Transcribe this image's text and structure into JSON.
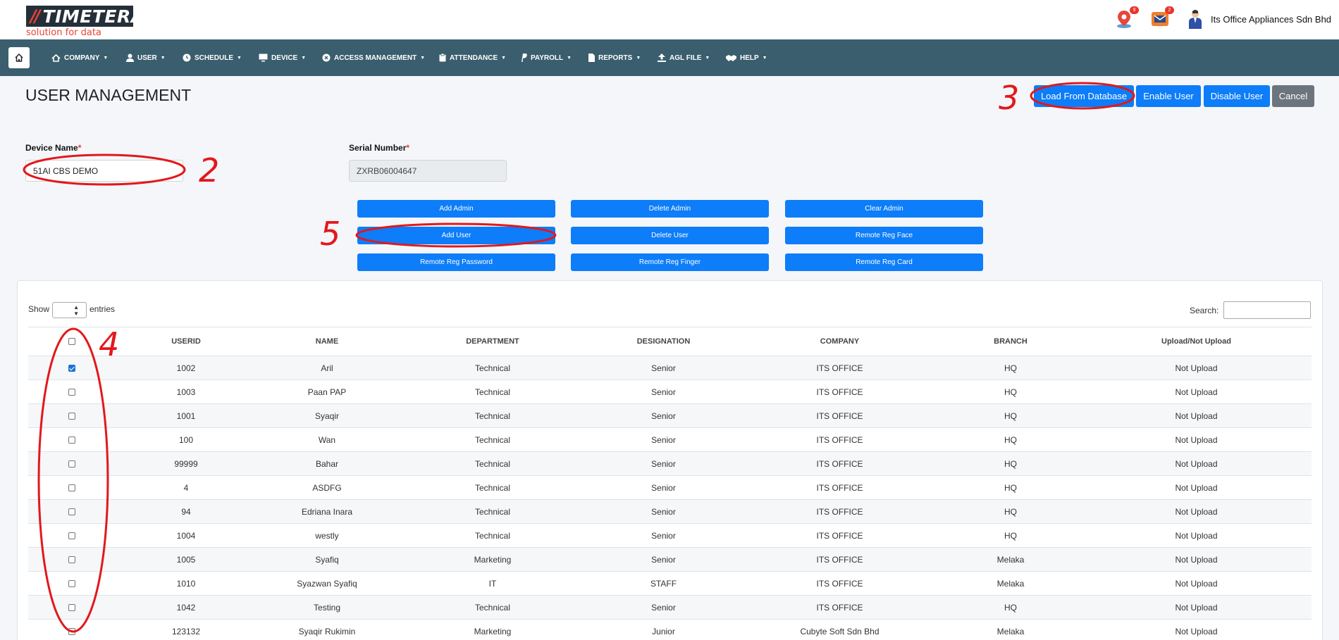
{
  "brand": {
    "name": "TIMETERA",
    "tagline": "solution for data"
  },
  "header": {
    "location_badge": "9",
    "mail_badge": "2",
    "company_name": "Its Office Appliances Sdn Bhd"
  },
  "nav": {
    "items": [
      {
        "label": "COMPANY",
        "icon": "company-icon"
      },
      {
        "label": "USER",
        "icon": "user-icon"
      },
      {
        "label": "SCHEDULE",
        "icon": "clock-icon"
      },
      {
        "label": "DEVICE",
        "icon": "monitor-icon"
      },
      {
        "label": "ACCESS MANAGEMENT",
        "icon": "access-icon"
      },
      {
        "label": "ATTENDANCE",
        "icon": "clipboard-icon"
      },
      {
        "label": "PAYROLL",
        "icon": "paypal-icon"
      },
      {
        "label": "REPORTS",
        "icon": "file-icon"
      },
      {
        "label": "AGL FILE",
        "icon": "upload-icon"
      },
      {
        "label": "HELP",
        "icon": "handshake-icon"
      }
    ]
  },
  "page": {
    "title": "USER MANAGEMENT"
  },
  "top_actions": {
    "load": "Load From Database",
    "enable": "Enable User",
    "disable": "Disable User",
    "cancel": "Cancel"
  },
  "form": {
    "device_label": "Device Name",
    "device_value": "51AI CBS DEMO",
    "serial_label": "Serial Number",
    "serial_value": "ZXRB06004647",
    "required_mark": "*"
  },
  "actions": {
    "add_admin": "Add Admin",
    "delete_admin": "Delete Admin",
    "clear_admin": "Clear Admin",
    "add_user": "Add User",
    "delete_user": "Delete User",
    "remote_face": "Remote Reg Face",
    "remote_password": "Remote Reg Password",
    "remote_finger": "Remote Reg Finger",
    "remote_card": "Remote Reg Card"
  },
  "table": {
    "show_label": "Show",
    "entries_label": "entries",
    "search_label": "Search:",
    "columns": [
      "USERID",
      "NAME",
      "DEPARTMENT",
      "DESIGNATION",
      "COMPANY",
      "BRANCH",
      "Upload/Not Upload"
    ],
    "rows": [
      {
        "checked": true,
        "cells": [
          "1002",
          "Aril",
          "Technical",
          "Senior",
          "ITS OFFICE",
          "HQ",
          "Not Upload"
        ]
      },
      {
        "checked": false,
        "cells": [
          "1003",
          "Paan PAP",
          "Technical",
          "Senior",
          "ITS OFFICE",
          "HQ",
          "Not Upload"
        ]
      },
      {
        "checked": false,
        "cells": [
          "1001",
          "Syaqir",
          "Technical",
          "Senior",
          "ITS OFFICE",
          "HQ",
          "Not Upload"
        ]
      },
      {
        "checked": false,
        "cells": [
          "100",
          "Wan",
          "Technical",
          "Senior",
          "ITS OFFICE",
          "HQ",
          "Not Upload"
        ]
      },
      {
        "checked": false,
        "cells": [
          "99999",
          "Bahar",
          "Technical",
          "Senior",
          "ITS OFFICE",
          "HQ",
          "Not Upload"
        ]
      },
      {
        "checked": false,
        "cells": [
          "4",
          "ASDFG",
          "Technical",
          "Senior",
          "ITS OFFICE",
          "HQ",
          "Not Upload"
        ]
      },
      {
        "checked": false,
        "cells": [
          "94",
          "Edriana Inara",
          "Technical",
          "Senior",
          "ITS OFFICE",
          "HQ",
          "Not Upload"
        ]
      },
      {
        "checked": false,
        "cells": [
          "1004",
          "westly",
          "Technical",
          "Senior",
          "ITS OFFICE",
          "HQ",
          "Not Upload"
        ]
      },
      {
        "checked": false,
        "cells": [
          "1005",
          "Syafiq",
          "Marketing",
          "Senior",
          "ITS OFFICE",
          "Melaka",
          "Not Upload"
        ]
      },
      {
        "checked": false,
        "cells": [
          "1010",
          "Syazwan Syafiq",
          "IT",
          "STAFF",
          "ITS OFFICE",
          "Melaka",
          "Not Upload"
        ]
      },
      {
        "checked": false,
        "cells": [
          "1042",
          "Testing",
          "Technical",
          "Senior",
          "ITS OFFICE",
          "HQ",
          "Not Upload"
        ]
      },
      {
        "checked": false,
        "cells": [
          "123132",
          "Syaqir Rukimin",
          "Marketing",
          "Junior",
          "Cubyte Soft Sdn Bhd",
          "Melaka",
          "Not Upload"
        ]
      }
    ]
  },
  "annotations": {
    "n2": "2",
    "n3": "3",
    "n4": "4",
    "n5": "5"
  },
  "colors": {
    "primary": "#0d7df9",
    "nav": "#3a5e6e",
    "annotation": "#e3171b",
    "secondary": "#6c757d"
  }
}
